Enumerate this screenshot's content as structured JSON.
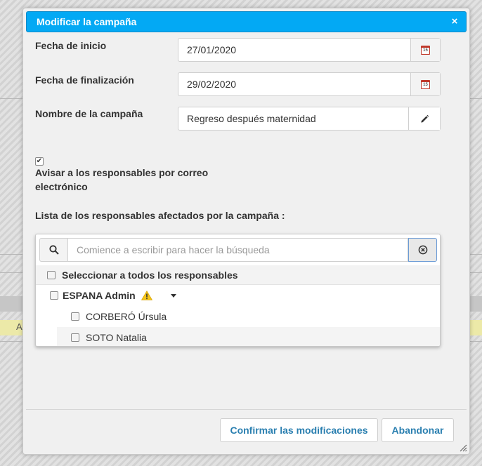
{
  "dialog": {
    "title": "Modificar la campaña",
    "close_glyph": "×"
  },
  "fields": {
    "start_date": {
      "label": "Fecha de inicio",
      "value": "27/01/2020",
      "icon": "calendar-icon"
    },
    "end_date": {
      "label": "Fecha de finalización",
      "value": "29/02/2020",
      "icon": "calendar-icon"
    },
    "campaign_name": {
      "label": "Nombre de la campaña",
      "value": "Regreso después maternidad",
      "icon": "pencil-icon"
    }
  },
  "calendar_day": "15",
  "notify": {
    "checked": true,
    "check_glyph": "✔",
    "label": "Avisar a los responsables por correo electrónico"
  },
  "list": {
    "label": "Lista de los responsables afectados por la campaña :",
    "search_placeholder": "Comience a escribir para hacer la búsqueda",
    "search_value": "",
    "select_all_label": "Seleccionar a todos los responsables",
    "group": {
      "name": "ESPANA Admin",
      "warning": true
    },
    "users": [
      {
        "name": "CORBERÓ Úrsula"
      },
      {
        "name": "SOTO Natalia"
      }
    ]
  },
  "footer": {
    "confirm_label": "Confirmar las modificaciones",
    "cancel_label": "Abandonar"
  },
  "colors": {
    "title_bar": "#03a9f4",
    "button_text": "#2a7fb0",
    "calendar_accent": "#c0392b",
    "warning": "#f5c518"
  }
}
